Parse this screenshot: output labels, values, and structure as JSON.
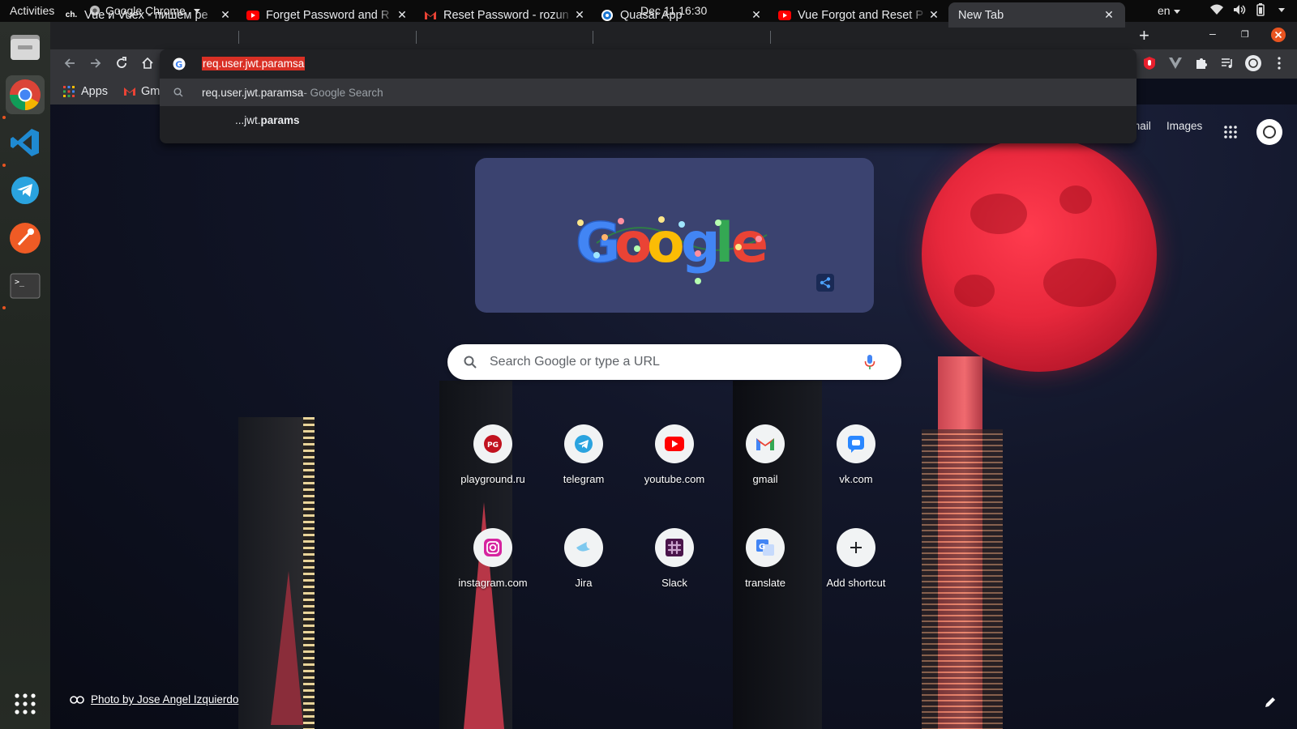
{
  "topbar": {
    "activities": "Activities",
    "app_name": "Google Chrome",
    "clock": "Dec 11  16:30",
    "language": "en"
  },
  "dock": {
    "items": [
      "files",
      "chrome",
      "vscode",
      "telegram",
      "postman",
      "terminal"
    ],
    "show_apps": "show-applications"
  },
  "tabs": [
    {
      "title": "Vue и Vuex - пишем ре",
      "favicon": "ch."
    },
    {
      "title": "Forget Password and R",
      "favicon": "youtube"
    },
    {
      "title": "Reset Password - rozun",
      "favicon": "gmail"
    },
    {
      "title": "Quasar App",
      "favicon": "quasar"
    },
    {
      "title": "Vue Forgot and Reset P",
      "favicon": "youtube"
    },
    {
      "title": "New Tab",
      "favicon": ""
    }
  ],
  "omnibox": {
    "value": "req.user.jwt.paramsa",
    "suggestions": [
      {
        "text": "req.user.jwt.paramsa",
        "suffix": " - Google Search"
      },
      {
        "text": "...jwt.",
        "bold": "params"
      }
    ]
  },
  "bookmarks": {
    "apps": "Apps",
    "gmail": "Gm"
  },
  "ntp": {
    "links": {
      "gmail": "mail",
      "images": "Images"
    },
    "search_placeholder": "Search Google or type a URL",
    "shortcuts": [
      {
        "label": "playground.ru",
        "icon": "playground-icon"
      },
      {
        "label": "telegram",
        "icon": "telegram-icon"
      },
      {
        "label": "youtube.com",
        "icon": "youtube-icon"
      },
      {
        "label": "gmail",
        "icon": "gmail-icon"
      },
      {
        "label": "vk.com",
        "icon": "vk-icon"
      },
      {
        "label": "instagram.com",
        "icon": "instagram-icon"
      },
      {
        "label": "Jira",
        "icon": "jira-icon"
      },
      {
        "label": "Slack",
        "icon": "slack-icon"
      },
      {
        "label": "translate",
        "icon": "translate-icon"
      },
      {
        "label": "Add shortcut",
        "icon": "plus-icon"
      }
    ],
    "photo_credit": "Photo by Jose Angel Izquierdo"
  },
  "colors": {
    "chrome_dark": "#202124",
    "toolbar": "#35363a",
    "selection": "#d93025",
    "moon": "#e8283c",
    "doodle_bg": "#3b4370"
  }
}
